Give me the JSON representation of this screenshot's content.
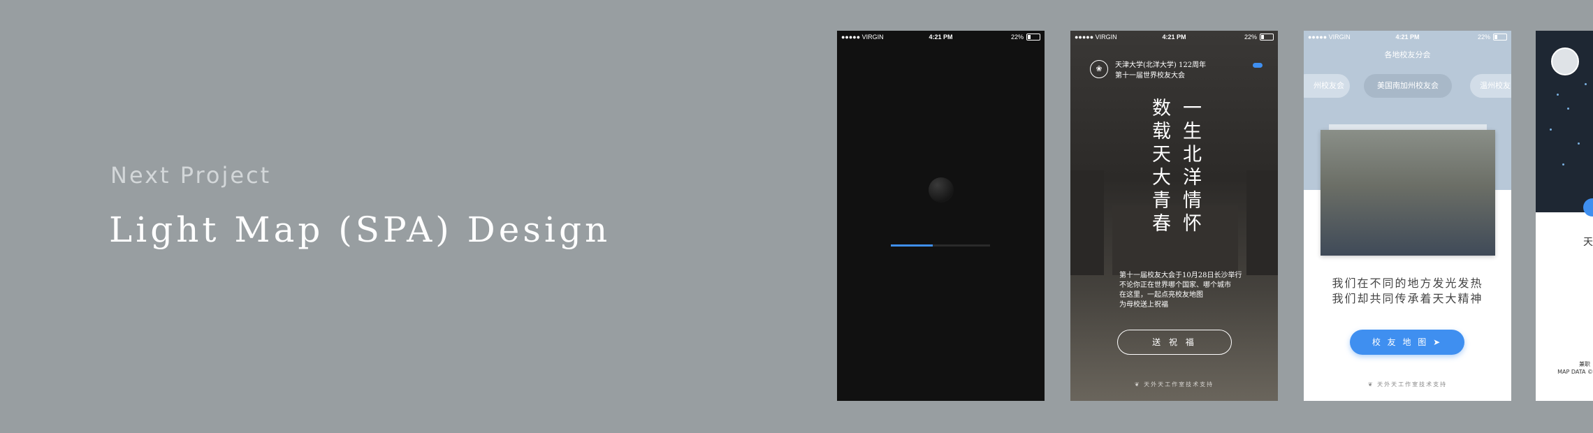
{
  "hero": {
    "eyebrow": "Next Project",
    "title": "Light Map (SPA) Design"
  },
  "status_bar": {
    "carrier": "●●●●● VIRGIN",
    "time": "4:21 PM",
    "battery": "22%"
  },
  "screen_loading": {
    "progress": 0.42,
    "accent_color": "#3f8ff0"
  },
  "screen_intro": {
    "header_line1": "天津大学(北洋大学) 122周年",
    "header_line2": "第十一届世界校友大会",
    "headline_right": "一生北洋情怀",
    "headline_left": "数载天大青春",
    "paragraph": [
      "第十一届校友大会于10月28日长沙举行",
      "不论你正在世界哪个国家、哪个城市",
      "在这里，一起点亮校友地图",
      "为母校送上祝福"
    ],
    "button_label": "送 祝 福",
    "footer": "天外天工作室技术支持",
    "logo_icon": "university-seal-icon"
  },
  "screen_alumni": {
    "title": "各地校友分会",
    "chips": [
      "州校友会",
      "美国南加州校友会",
      "温州校友"
    ],
    "active_chip": 1,
    "line1": "我们在不同的地方发光发热",
    "line2": "我们却共同传承着天大精神",
    "button_label": "校 友 地 图",
    "button_icon": "send-arrow-icon",
    "footer": "天外天工作室技术支持"
  },
  "screen_map": {
    "partial_char": "天",
    "credit_line1": "兼职",
    "credit_line2": "MAP DATA ©"
  }
}
